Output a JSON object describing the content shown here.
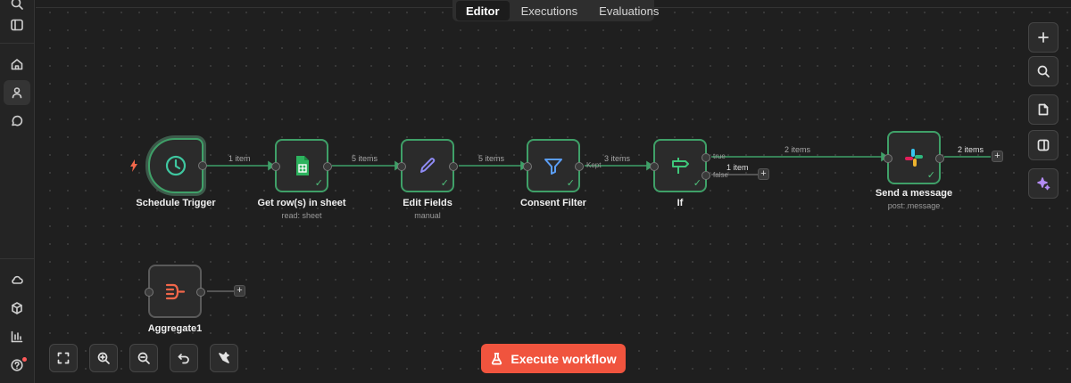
{
  "tabs": [
    {
      "label": "Editor",
      "active": true
    },
    {
      "label": "Executions",
      "active": false
    },
    {
      "label": "Evaluations",
      "active": false
    }
  ],
  "nodes": {
    "schedule": {
      "label": "Schedule Trigger",
      "sub": "",
      "icon": "clock-icon"
    },
    "sheet": {
      "label": "Get row(s) in sheet",
      "sub": "read: sheet",
      "icon": "google-sheets-icon"
    },
    "edit": {
      "label": "Edit Fields",
      "sub": "manual",
      "icon": "pencil-icon"
    },
    "filter": {
      "label": "Consent Filter",
      "sub": "",
      "icon": "filter-icon"
    },
    "if": {
      "label": "If",
      "sub": "",
      "icon": "signpost-icon"
    },
    "slack": {
      "label": "Send a message",
      "sub": "post: message",
      "icon": "slack-icon"
    },
    "aggregate": {
      "label": "Aggregate1",
      "sub": "",
      "icon": "aggregate-icon"
    }
  },
  "edges": {
    "e1": "1 item",
    "e2": "5 items",
    "e3": "5 items",
    "e4": "3 items",
    "e5": "2 items",
    "e6": "1 item",
    "e7": "2 items"
  },
  "ports": {
    "kept": "Kept",
    "true": "true",
    "false": "false"
  },
  "execute_button": "Execute workflow",
  "colors": {
    "accent": "#f0543e",
    "success": "#3fa068",
    "sheets": "#2db35e",
    "edit": "#8f8bf5",
    "filter": "#5b9ef5",
    "if": "#3fc77a",
    "aggregate": "#f2674a"
  }
}
